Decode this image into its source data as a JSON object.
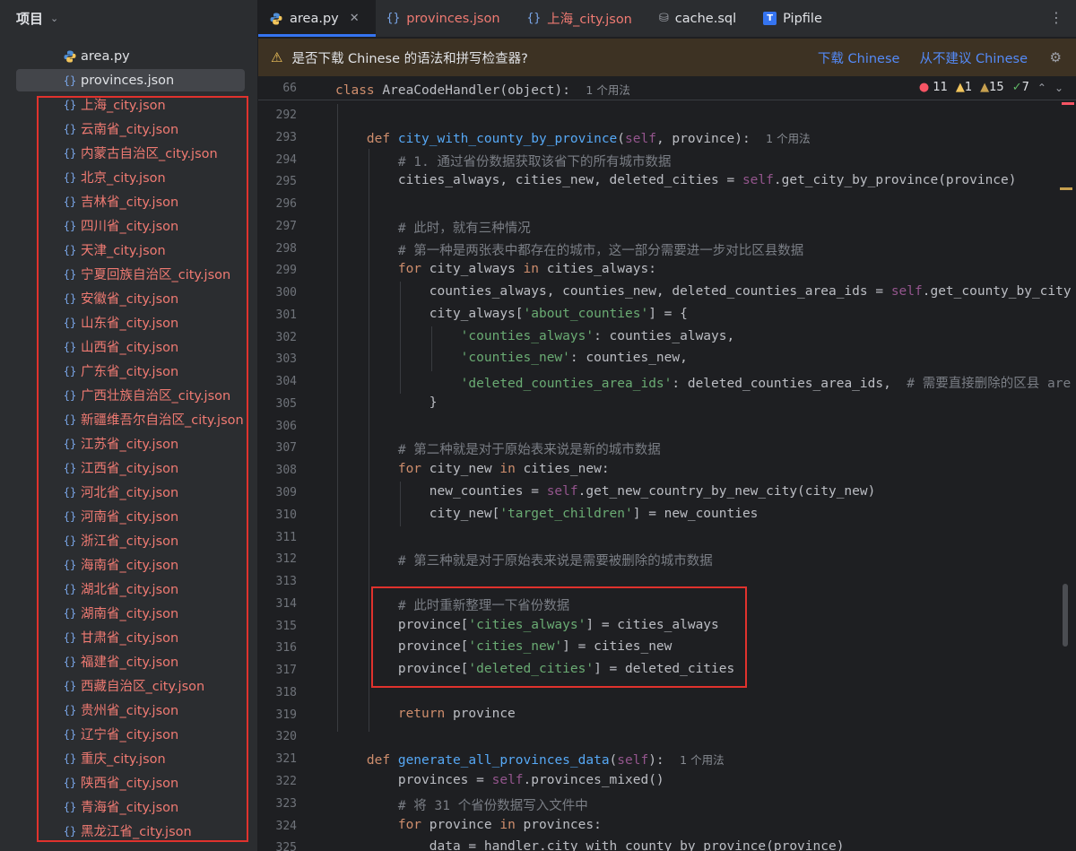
{
  "sidebar": {
    "title": "项目",
    "files": [
      {
        "name": "area.py",
        "icon": "python-icon",
        "kind": "py"
      },
      {
        "name": "provinces.json",
        "icon": "json-braces-icon",
        "kind": "json-plain",
        "selected": true
      },
      {
        "name": "上海_city.json",
        "icon": "json-braces-icon",
        "kind": "json"
      },
      {
        "name": "云南省_city.json",
        "icon": "json-braces-icon",
        "kind": "json"
      },
      {
        "name": "内蒙古自治区_city.json",
        "icon": "json-braces-icon",
        "kind": "json"
      },
      {
        "name": "北京_city.json",
        "icon": "json-braces-icon",
        "kind": "json"
      },
      {
        "name": "吉林省_city.json",
        "icon": "json-braces-icon",
        "kind": "json"
      },
      {
        "name": "四川省_city.json",
        "icon": "json-braces-icon",
        "kind": "json"
      },
      {
        "name": "天津_city.json",
        "icon": "json-braces-icon",
        "kind": "json"
      },
      {
        "name": "宁夏回族自治区_city.json",
        "icon": "json-braces-icon",
        "kind": "json"
      },
      {
        "name": "安徽省_city.json",
        "icon": "json-braces-icon",
        "kind": "json"
      },
      {
        "name": "山东省_city.json",
        "icon": "json-braces-icon",
        "kind": "json"
      },
      {
        "name": "山西省_city.json",
        "icon": "json-braces-icon",
        "kind": "json"
      },
      {
        "name": "广东省_city.json",
        "icon": "json-braces-icon",
        "kind": "json"
      },
      {
        "name": "广西壮族自治区_city.json",
        "icon": "json-braces-icon",
        "kind": "json"
      },
      {
        "name": "新疆维吾尔自治区_city.json",
        "icon": "json-braces-icon",
        "kind": "json"
      },
      {
        "name": "江苏省_city.json",
        "icon": "json-braces-icon",
        "kind": "json"
      },
      {
        "name": "江西省_city.json",
        "icon": "json-braces-icon",
        "kind": "json"
      },
      {
        "name": "河北省_city.json",
        "icon": "json-braces-icon",
        "kind": "json"
      },
      {
        "name": "河南省_city.json",
        "icon": "json-braces-icon",
        "kind": "json"
      },
      {
        "name": "浙江省_city.json",
        "icon": "json-braces-icon",
        "kind": "json"
      },
      {
        "name": "海南省_city.json",
        "icon": "json-braces-icon",
        "kind": "json"
      },
      {
        "name": "湖北省_city.json",
        "icon": "json-braces-icon",
        "kind": "json"
      },
      {
        "name": "湖南省_city.json",
        "icon": "json-braces-icon",
        "kind": "json"
      },
      {
        "name": "甘肃省_city.json",
        "icon": "json-braces-icon",
        "kind": "json"
      },
      {
        "name": "福建省_city.json",
        "icon": "json-braces-icon",
        "kind": "json"
      },
      {
        "name": "西藏自治区_city.json",
        "icon": "json-braces-icon",
        "kind": "json"
      },
      {
        "name": "贵州省_city.json",
        "icon": "json-braces-icon",
        "kind": "json"
      },
      {
        "name": "辽宁省_city.json",
        "icon": "json-braces-icon",
        "kind": "json"
      },
      {
        "name": "重庆_city.json",
        "icon": "json-braces-icon",
        "kind": "json"
      },
      {
        "name": "陕西省_city.json",
        "icon": "json-braces-icon",
        "kind": "json"
      },
      {
        "name": "青海省_city.json",
        "icon": "json-braces-icon",
        "kind": "json"
      },
      {
        "name": "黑龙江省_city.json",
        "icon": "json-braces-icon",
        "kind": "json"
      }
    ]
  },
  "tabs": [
    {
      "label": "area.py",
      "icon": "python-icon",
      "active": true,
      "closable": true
    },
    {
      "label": "provinces.json",
      "icon": "json-braces-icon",
      "active": false,
      "red": true
    },
    {
      "label": "上海_city.json",
      "icon": "json-braces-icon",
      "active": false,
      "red": true
    },
    {
      "label": "cache.sql",
      "icon": "database-icon",
      "active": false
    },
    {
      "label": "Pipfile",
      "icon": "pipfile-icon",
      "active": false
    }
  ],
  "notification": {
    "message": "是否下载 Chinese 的语法和拼写检查器?",
    "download": "下载 Chinese",
    "dismiss": "从不建议 Chinese"
  },
  "sticky_header": {
    "line": "66",
    "code": [
      [
        "kw",
        "class "
      ],
      [
        "tx",
        "AreaCodeHandler("
      ],
      [
        "tx",
        "object"
      ],
      [
        "tx",
        "):"
      ]
    ],
    "hint": "1 个用法"
  },
  "inspections": {
    "errors": "11",
    "warnings": "1",
    "weak_warnings": "15",
    "ok": "7"
  },
  "code": [
    {
      "n": "292",
      "t": []
    },
    {
      "n": "293",
      "t": [
        [
          "kw",
          "    def "
        ],
        [
          "fn",
          "city_with_county_by_province"
        ],
        [
          "tx",
          "("
        ],
        [
          "sf",
          "self"
        ],
        [
          "tx",
          ", province):"
        ]
      ],
      "hint": "1 个用法"
    },
    {
      "n": "294",
      "t": [
        [
          "cm",
          "        # 1. 通过省份数据获取该省下的所有城市数据"
        ]
      ]
    },
    {
      "n": "295",
      "t": [
        [
          "tx",
          "        cities_always, cities_new, deleted_cities = "
        ],
        [
          "sf",
          "self"
        ],
        [
          "tx",
          ".get_city_by_province(province)"
        ]
      ]
    },
    {
      "n": "296",
      "t": []
    },
    {
      "n": "297",
      "t": [
        [
          "cm",
          "        # 此时，就有三种情况"
        ]
      ]
    },
    {
      "n": "298",
      "t": [
        [
          "cm",
          "        # 第一种是两张表中都存在的城市，这一部分需要进一步对比区县数据"
        ]
      ]
    },
    {
      "n": "299",
      "t": [
        [
          "kw",
          "        for "
        ],
        [
          "tx",
          "city_always "
        ],
        [
          "kw",
          "in "
        ],
        [
          "tx",
          "cities_always:"
        ]
      ]
    },
    {
      "n": "300",
      "t": [
        [
          "tx",
          "            counties_always, counties_new, deleted_counties_area_ids = "
        ],
        [
          "sf",
          "self"
        ],
        [
          "tx",
          ".get_county_by_city"
        ]
      ]
    },
    {
      "n": "301",
      "t": [
        [
          "tx",
          "            city_always["
        ],
        [
          "str",
          "'about_counties'"
        ],
        [
          "tx",
          "] = {"
        ]
      ]
    },
    {
      "n": "302",
      "t": [
        [
          "str",
          "                'counties_always'"
        ],
        [
          "tx",
          ": counties_always,"
        ]
      ]
    },
    {
      "n": "303",
      "t": [
        [
          "str",
          "                'counties_new'"
        ],
        [
          "tx",
          ": counties_new,"
        ]
      ]
    },
    {
      "n": "304",
      "t": [
        [
          "str",
          "                'deleted_counties_area_ids'"
        ],
        [
          "tx",
          ": deleted_counties_area_ids,  "
        ],
        [
          "cm",
          "# 需要直接删除的区县 are"
        ]
      ]
    },
    {
      "n": "305",
      "t": [
        [
          "tx",
          "            }"
        ]
      ]
    },
    {
      "n": "306",
      "t": []
    },
    {
      "n": "307",
      "t": [
        [
          "cm",
          "        # 第二种就是对于原始表来说是新的城市数据"
        ]
      ]
    },
    {
      "n": "308",
      "t": [
        [
          "kw",
          "        for "
        ],
        [
          "tx",
          "city_new "
        ],
        [
          "kw",
          "in "
        ],
        [
          "tx",
          "cities_new:"
        ]
      ]
    },
    {
      "n": "309",
      "t": [
        [
          "tx",
          "            new_counties = "
        ],
        [
          "sf",
          "self"
        ],
        [
          "tx",
          ".get_new_country_by_new_city(city_new)"
        ]
      ]
    },
    {
      "n": "310",
      "t": [
        [
          "tx",
          "            city_new["
        ],
        [
          "str",
          "'target_children'"
        ],
        [
          "tx",
          "] = new_counties"
        ]
      ]
    },
    {
      "n": "311",
      "t": []
    },
    {
      "n": "312",
      "t": [
        [
          "cm",
          "        # 第三种就是对于原始表来说是需要被删除的城市数据"
        ]
      ]
    },
    {
      "n": "313",
      "t": []
    },
    {
      "n": "314",
      "t": [
        [
          "cm",
          "        # 此时重新整理一下省份数据"
        ]
      ]
    },
    {
      "n": "315",
      "t": [
        [
          "tx",
          "        province["
        ],
        [
          "str",
          "'cities_always'"
        ],
        [
          "tx",
          "] = cities_always"
        ]
      ]
    },
    {
      "n": "316",
      "t": [
        [
          "tx",
          "        province["
        ],
        [
          "str",
          "'cities_new'"
        ],
        [
          "tx",
          "] = cities_new"
        ]
      ]
    },
    {
      "n": "317",
      "t": [
        [
          "tx",
          "        province["
        ],
        [
          "str",
          "'deleted_cities'"
        ],
        [
          "tx",
          "] = deleted_cities"
        ]
      ]
    },
    {
      "n": "318",
      "t": []
    },
    {
      "n": "319",
      "t": [
        [
          "kw",
          "        return "
        ],
        [
          "tx",
          "province"
        ]
      ]
    },
    {
      "n": "320",
      "t": []
    },
    {
      "n": "321",
      "t": [
        [
          "kw",
          "    def "
        ],
        [
          "fn",
          "generate_all_provinces_data"
        ],
        [
          "tx",
          "("
        ],
        [
          "sf",
          "self"
        ],
        [
          "tx",
          "):"
        ]
      ],
      "hint": "1 个用法"
    },
    {
      "n": "322",
      "t": [
        [
          "tx",
          "        provinces = "
        ],
        [
          "sf",
          "self"
        ],
        [
          "tx",
          ".provinces_mixed()"
        ]
      ]
    },
    {
      "n": "323",
      "t": [
        [
          "cm",
          "        # 将 31 个省份数据写入文件中"
        ]
      ]
    },
    {
      "n": "324",
      "t": [
        [
          "kw",
          "        for "
        ],
        [
          "tx",
          "province "
        ],
        [
          "kw",
          "in "
        ],
        [
          "tx",
          "provinces:"
        ]
      ]
    },
    {
      "n": "325",
      "t": [
        [
          "tx",
          "            data = handler.city_with_county_by_province(province)"
        ]
      ]
    }
  ],
  "colors": {
    "accent": "#3574f0",
    "annotation_red": "#e0322d",
    "modified_file": "#ef7a72",
    "warning_bar": "#3d3223"
  }
}
